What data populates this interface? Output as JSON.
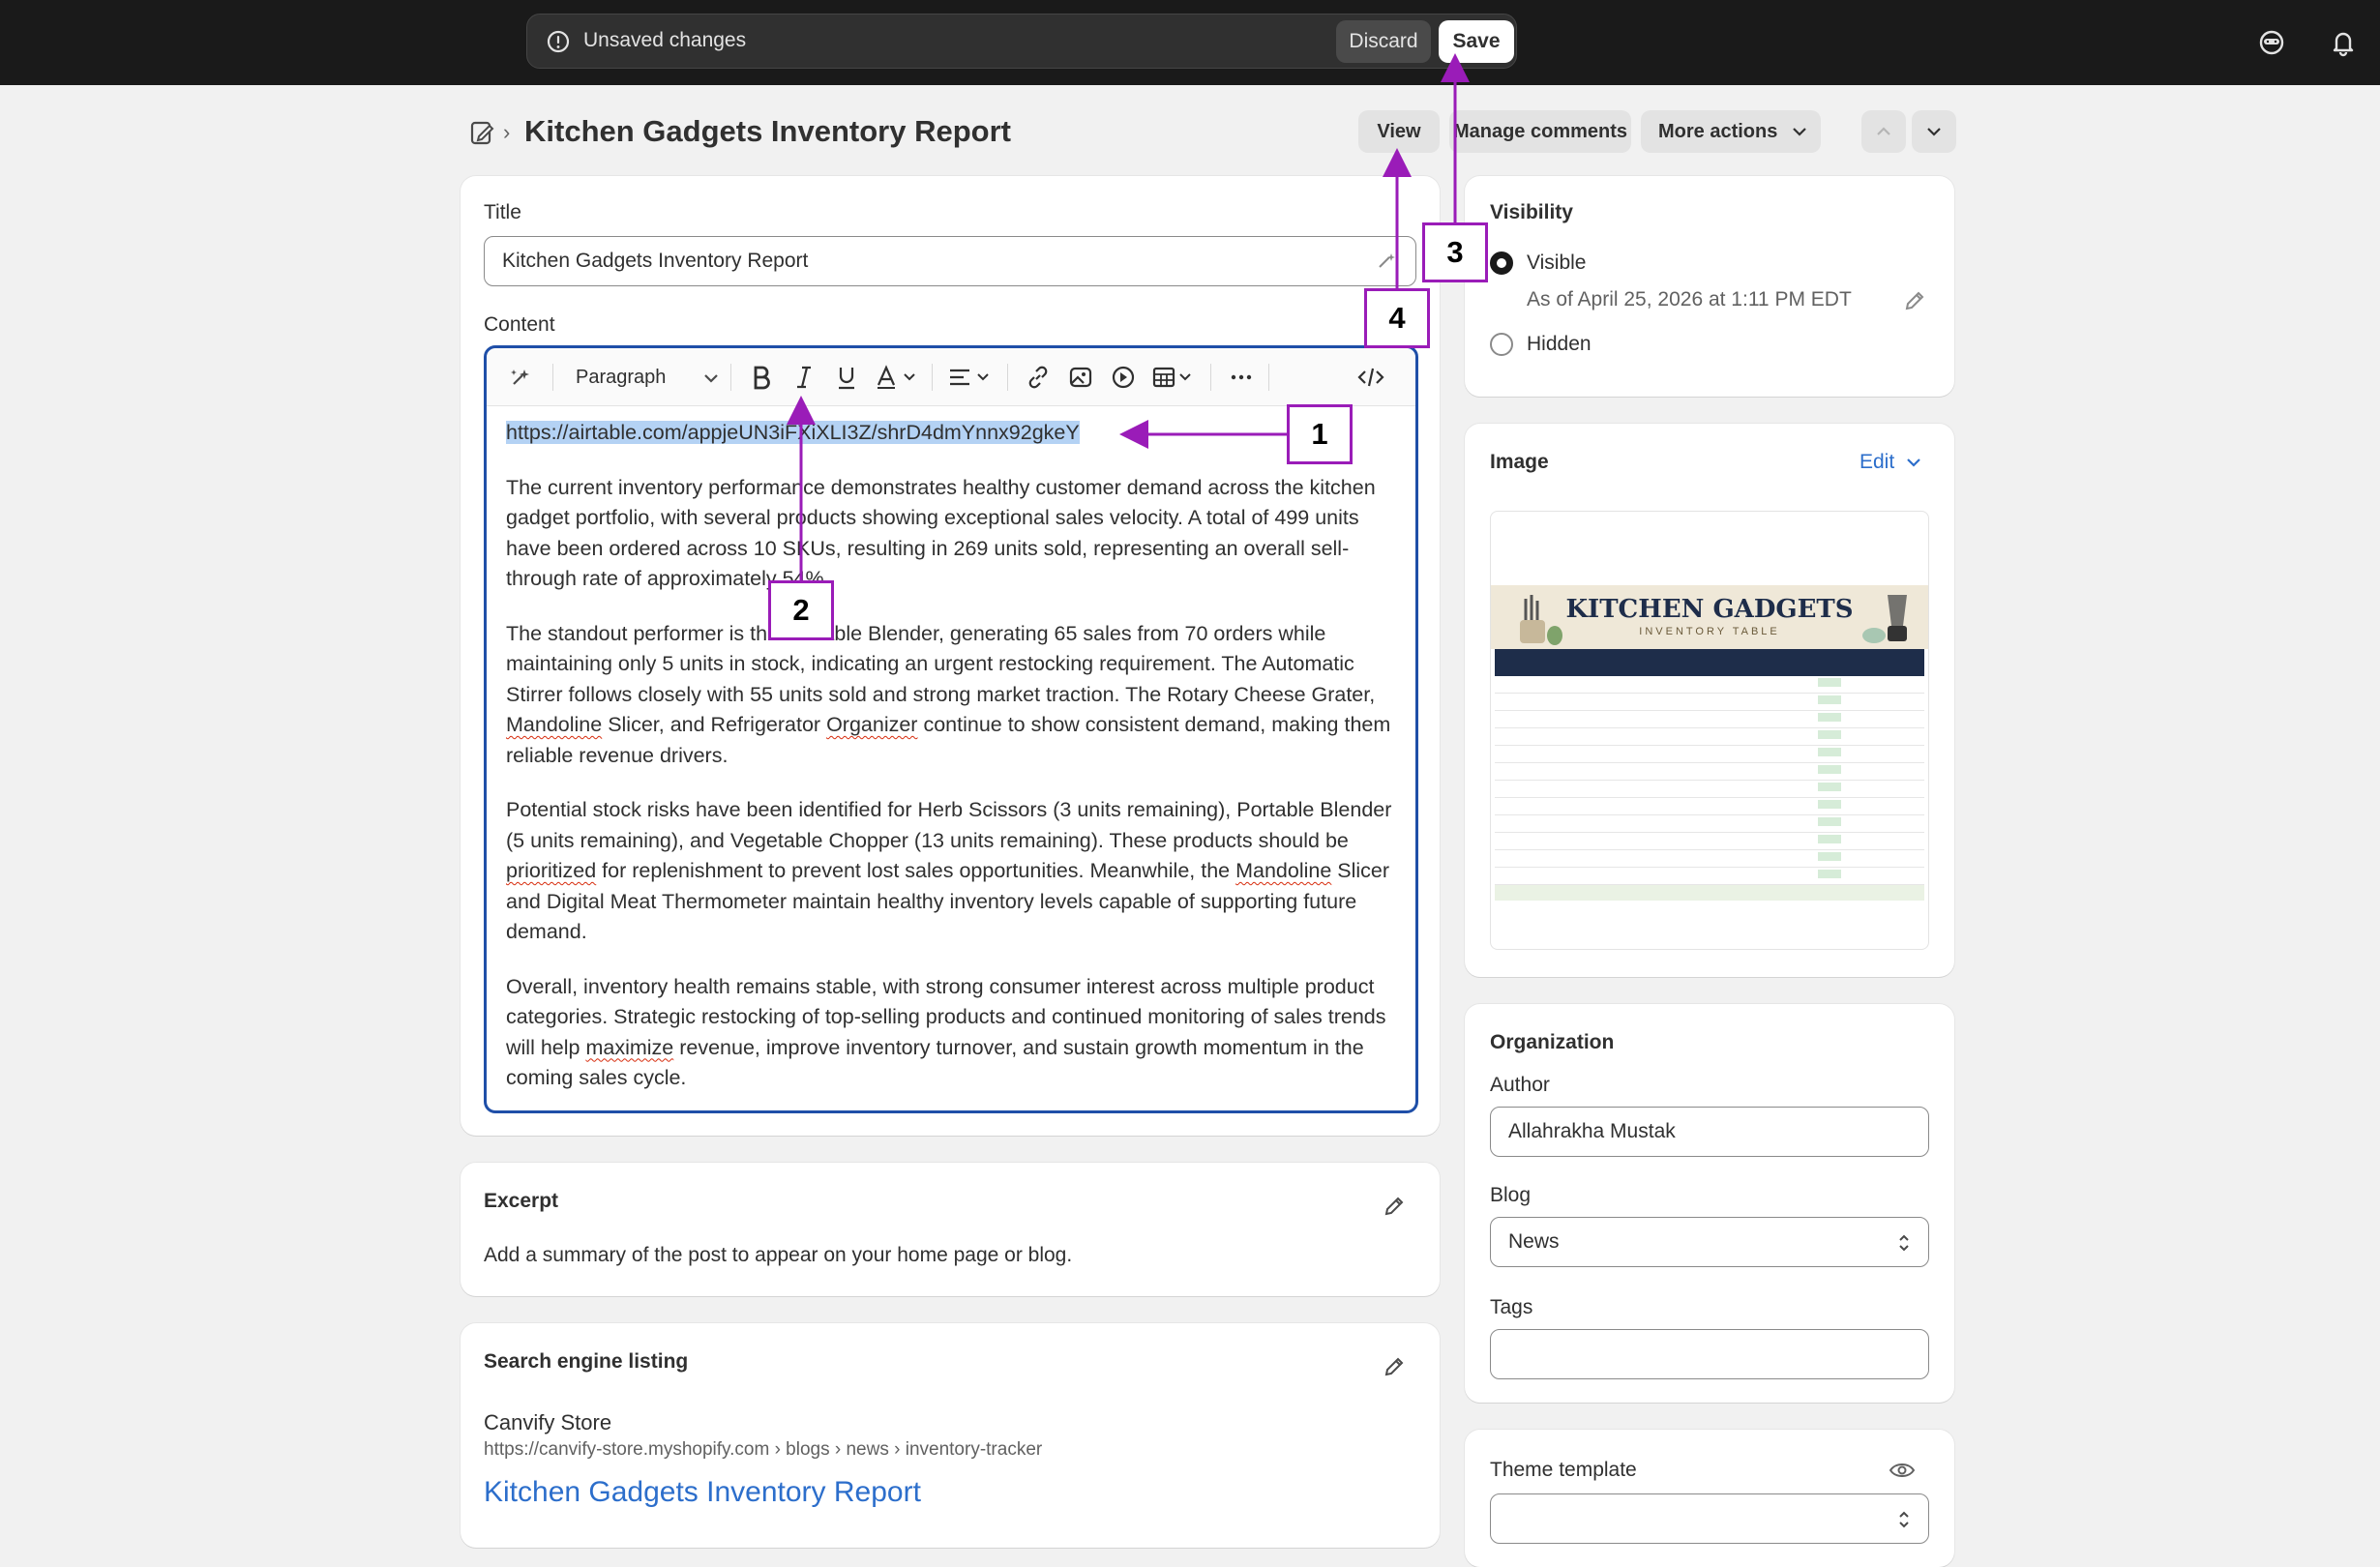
{
  "topbar": {
    "unsaved_text": "Unsaved changes",
    "discard_label": "Discard",
    "save_label": "Save"
  },
  "header": {
    "title": "Kitchen Gadgets Inventory Report",
    "view_label": "View",
    "manage_comments_label": "Manage comments",
    "more_actions_label": "More actions"
  },
  "main": {
    "title_label": "Title",
    "title_value": "Kitchen Gadgets Inventory Report",
    "content_label": "Content",
    "paragraph_select": "Paragraph",
    "url": "https://airtable.com/appjeUN3iFXiXLI3Z/shrD4dmYnnx92gkeY",
    "p1": "The current inventory performance demonstrates healthy customer demand across the kitchen gadget portfolio, with several products showing exceptional sales velocity. A total of 499 units have been ordered across 10 SKUs, resulting in 269 units sold, representing an overall sell-through rate of approximately 54%.",
    "p2a": "The standout performer is the Portable Blender, generating 65 sales from 70 orders while maintaining only 5 units in stock, indicating an urgent restocking requirement. The Automatic Stirrer follows closely with 55 units sold and strong market traction. The Rotary Cheese Grater, ",
    "p2_mandoline": "Mandoline",
    "p2b": " Slicer, and Refrigerator ",
    "p2_organizer": "Organizer",
    "p2c": " continue to show consistent demand, making them reliable revenue drivers.",
    "p3a": "Potential stock risks have been identified for Herb Scissors (3 units remaining), Portable Blender (5 units remaining), and Vegetable Chopper (13 units remaining). These products should be ",
    "p3_prioritized": "prioritized",
    "p3b": " for replenishment to prevent lost sales opportunities. Meanwhile, the ",
    "p3_mandoline": "Mandoline",
    "p3c": " Slicer and Digital Meat Thermometer maintain healthy inventory levels capable of supporting future demand.",
    "p4a": "Overall, inventory health remains stable, with strong consumer interest across multiple product categories. Strategic restocking of top-selling products and continued monitoring of sales trends will help ",
    "p4_maximize": "maximize",
    "p4b": " revenue, improve inventory turnover, and sustain growth momentum in the coming sales cycle."
  },
  "excerpt": {
    "heading": "Excerpt",
    "text": "Add a summary of the post to appear on your home page or blog."
  },
  "seo": {
    "heading": "Search engine listing",
    "store": "Canvify Store",
    "url": "https://canvify-store.myshopify.com › blogs › news › inventory-tracker",
    "link_title": "Kitchen Gadgets Inventory Report"
  },
  "visibility": {
    "heading": "Visibility",
    "visible_label": "Visible",
    "visible_date": "As of April 25, 2026 at 1:11 PM EDT",
    "hidden_label": "Hidden"
  },
  "image": {
    "heading": "Image",
    "edit_label": "Edit",
    "thumb_title": "KITCHEN GADGETS",
    "thumb_subtitle": "INVENTORY TABLE"
  },
  "organization": {
    "heading": "Organization",
    "author_label": "Author",
    "author_value": "Allahrakha Mustak",
    "blog_label": "Blog",
    "blog_value": "News",
    "tags_label": "Tags",
    "tags_value": ""
  },
  "theme": {
    "heading": "Theme template",
    "value": ""
  },
  "annotations": {
    "one": "1",
    "two": "2",
    "three": "3",
    "four": "4"
  },
  "colors": {
    "annotation": "#9a1cb8",
    "link": "#2c6ecb",
    "focus": "#1f4fa8"
  }
}
